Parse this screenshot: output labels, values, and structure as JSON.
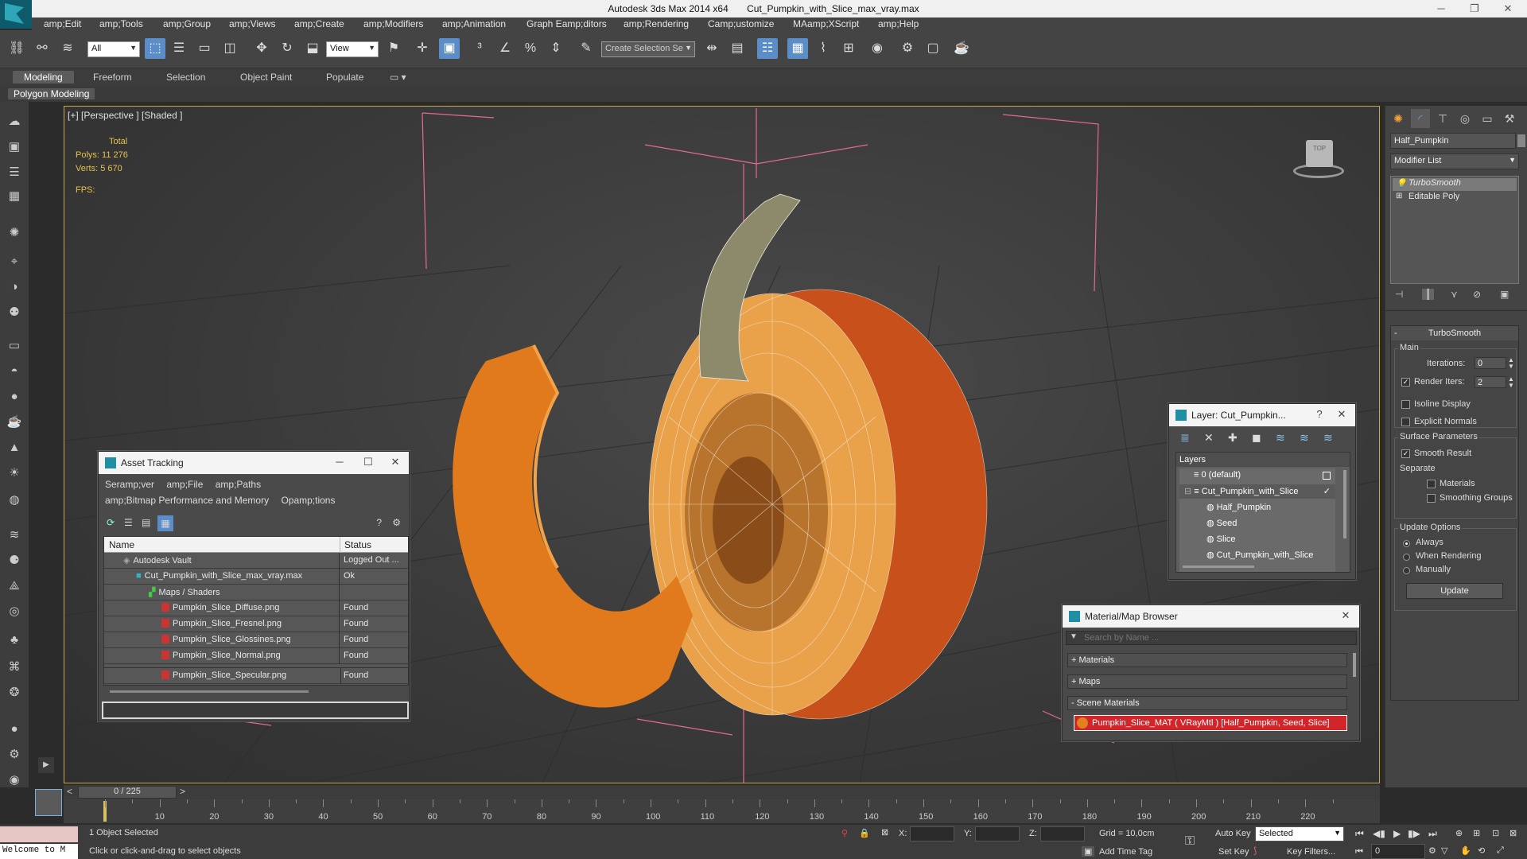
{
  "window": {
    "app_title": "Autodesk 3ds Max  2014 x64",
    "file_title": "Cut_Pumpkin_with_Slice_max_vray.max"
  },
  "menu": [
    "amp;Edit",
    "amp;Tools",
    "amp;Group",
    "amp;Views",
    "amp;Create",
    "amp;Modifiers",
    "amp;Animation",
    "Graph Eamp;ditors",
    "amp;Rendering",
    "Camp;ustomize",
    "MAamp;XScript",
    "amp;Help"
  ],
  "toolbar": {
    "selection_filter": "All",
    "ref_coord": "View",
    "named_selection_placeholder": "Create Selection Se"
  },
  "ribbon": {
    "tabs": [
      "Modeling",
      "Freeform",
      "Selection",
      "Object Paint",
      "Populate"
    ],
    "sub_label": "Polygon Modeling"
  },
  "viewport": {
    "label": "[+] [Perspective ] [Shaded ]",
    "stats_total": "Total",
    "polys_label": "Polys:",
    "polys_value": "11 276",
    "verts_label": "Verts:",
    "verts_value": "5 670",
    "fps_label": "FPS:",
    "viewcube_text": "TOP"
  },
  "asset_tracking": {
    "title": "Asset Tracking",
    "menu_row1": [
      "Seramp;ver",
      "amp;File",
      "amp;Paths"
    ],
    "menu_row2": [
      "amp;Bitmap Performance and Memory",
      "Opamp;tions"
    ],
    "col_name": "Name",
    "col_status": "Status",
    "rows": [
      {
        "name": "Autodesk Vault",
        "status": "Logged Out ..."
      },
      {
        "name": "Cut_Pumpkin_with_Slice_max_vray.max",
        "status": "Ok"
      },
      {
        "name": "Maps / Shaders",
        "status": ""
      },
      {
        "name": "Pumpkin_Slice_Diffuse.png",
        "status": "Found"
      },
      {
        "name": "Pumpkin_Slice_Fresnel.png",
        "status": "Found"
      },
      {
        "name": "Pumpkin_Slice_Glossines.png",
        "status": "Found"
      },
      {
        "name": "Pumpkin_Slice_Normal.png",
        "status": "Found"
      },
      {
        "name": "Pumpkin_Slice_Specular.png",
        "status": "Found"
      }
    ]
  },
  "layer_panel": {
    "title": "Layer: Cut_Pumpkin...",
    "help": "?",
    "header": "Layers",
    "items": [
      "0 (default)",
      "Cut_Pumpkin_with_Slice",
      "Half_Pumpkin",
      "Seed",
      "Slice",
      "Cut_Pumpkin_with_Slice"
    ]
  },
  "material_browser": {
    "title": "Material/Map Browser",
    "search_placeholder": "Search by Name ...",
    "sections": [
      "+ Materials",
      "+ Maps",
      "- Scene Materials"
    ],
    "scene_material": "Pumpkin_Slice_MAT  ( VRayMtl ) [Half_Pumpkin, Seed, Slice]"
  },
  "command_panel": {
    "object_name": "Half_Pumpkin",
    "modifier_list": "Modifier List",
    "stack": [
      "TurboSmooth",
      "Editable Poly"
    ],
    "rollout_title": "TurboSmooth",
    "main_group": "Main",
    "iterations_label": "Iterations:",
    "iterations_value": "0",
    "render_iters_label": "Render Iters:",
    "render_iters_value": "2",
    "isoline_label": "Isoline Display",
    "explicit_normals_label": "Explicit Normals",
    "surface_group": "Surface Parameters",
    "smooth_result_label": "Smooth Result",
    "separate_label": "Separate",
    "materials_label": "Materials",
    "smoothing_groups_label": "Smoothing Groups",
    "update_group": "Update Options",
    "always_label": "Always",
    "when_rendering_label": "When Rendering",
    "manually_label": "Manually",
    "update_button": "Update"
  },
  "timeline": {
    "frame_counter": "0 / 225",
    "ticks": [
      "10",
      "20",
      "30",
      "40",
      "50",
      "60",
      "70",
      "80",
      "90",
      "100",
      "110",
      "120",
      "130",
      "140",
      "150",
      "160",
      "170",
      "180",
      "190",
      "200",
      "210",
      "220"
    ]
  },
  "status": {
    "maxscript": "Welcome to M",
    "selected": "1 Object Selected",
    "prompt": "Click or click-and-drag to select objects",
    "x_label": "X:",
    "y_label": "Y:",
    "z_label": "Z:",
    "grid": "Grid = 10,0cm",
    "add_time_tag": "Add Time Tag",
    "auto_key": "Auto Key",
    "set_key": "Set Key",
    "key_mode": "Selected",
    "key_filters": "Key Filters...",
    "frame_value": "0"
  }
}
